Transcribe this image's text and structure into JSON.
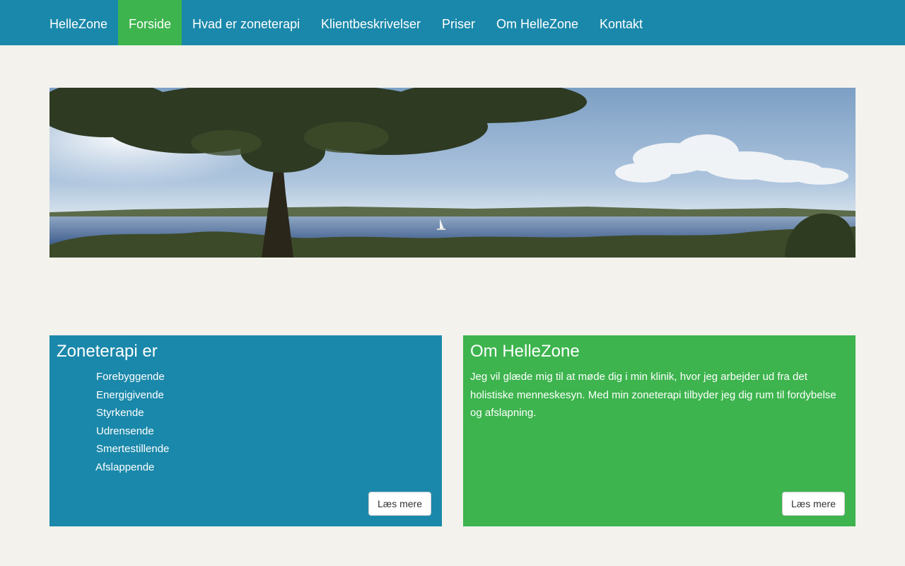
{
  "nav": {
    "brand": "HelleZone",
    "items": [
      {
        "label": "Forside",
        "active": true
      },
      {
        "label": "Hvad er zoneterapi"
      },
      {
        "label": "Klientbeskrivelser"
      },
      {
        "label": "Priser"
      },
      {
        "label": "Om HelleZone"
      },
      {
        "label": "Kontakt"
      }
    ]
  },
  "colors": {
    "nav_bg": "#1a88aa",
    "active": "#3db44e",
    "page_bg": "#f3f2ed"
  },
  "panels": {
    "zoneterapi": {
      "title": "Zoneterapi er",
      "items": [
        "Forebyggende",
        "Energigivende",
        "Styrkende",
        "Udrensende",
        "Smertestillende",
        "Afslappende"
      ],
      "button": "Læs mere"
    },
    "om": {
      "title": "Om HelleZone",
      "text": "Jeg vil glæde mig til at møde dig i min klinik, hvor jeg arbejder ud fra det holistiske menneskesyn. Med min zoneterapi tilbyder jeg dig rum til fordybelse og afslapning.",
      "button": "Læs mere"
    }
  }
}
